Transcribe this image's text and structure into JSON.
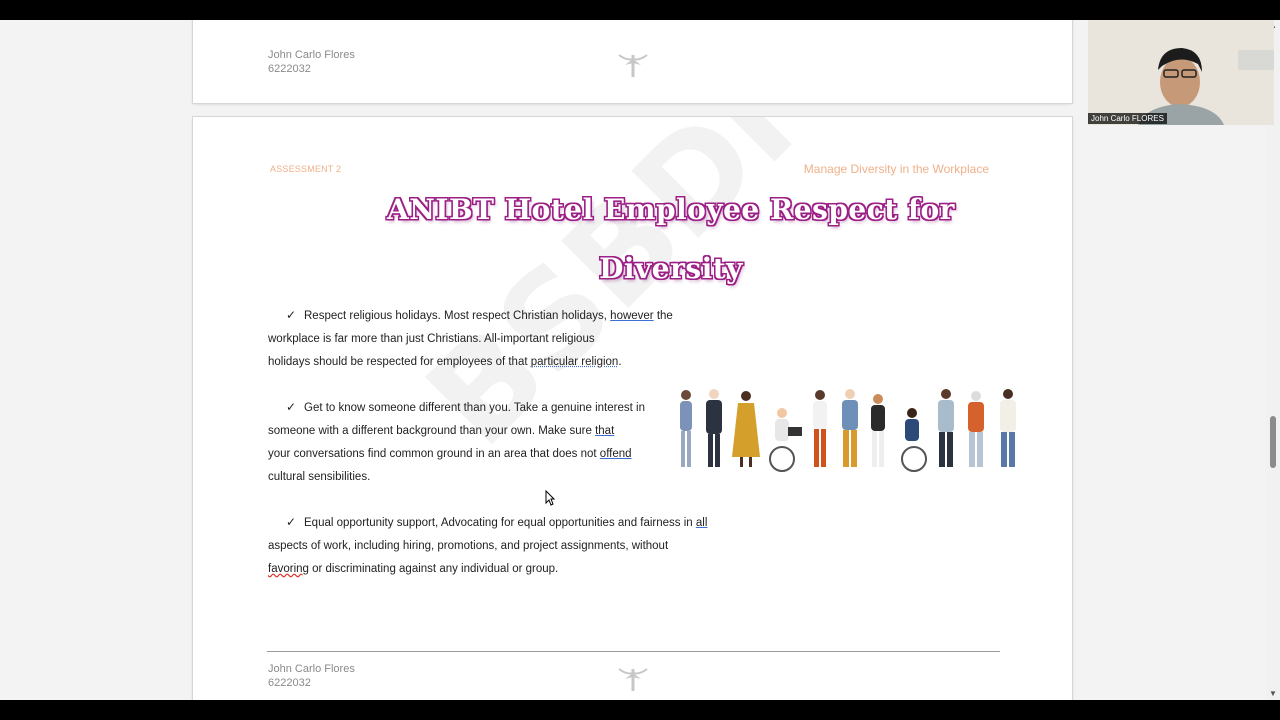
{
  "prev_page": {
    "footer_name": "John Carlo Flores",
    "footer_id": "6222032"
  },
  "page": {
    "header_left": "ASSESSMENT 2",
    "header_right": "Manage Diversity in the Workplace",
    "title_line1": "ANIBT Hotel Employee Respect for",
    "title_line2": "Diversity",
    "watermark": "BSBDIV501",
    "bullets": [
      {
        "line1_pre": "Respect religious holidays. Most respect Christian holidays, ",
        "line1_u": "however",
        "line1_post": " the",
        "line2": "workplace is far more than just Christians. All-important religious",
        "line3_pre": "holidays should be respected for employees of that ",
        "line3_u": "particular religion",
        "line3_post": "."
      },
      {
        "line1": "Get to know someone different than you. Take a genuine interest in",
        "line2_pre": "someone with a different background than your own. Make sure ",
        "line2_u": "that",
        "line3_pre": "your conversations find common ground in an area that does not ",
        "line3_u": "offend",
        "line4": "cultural sensibilities."
      },
      {
        "line1_pre": "Equal opportunity support, Advocating for equal opportunities and fairness in ",
        "line1_u": "all",
        "line2": "aspects of work, including hiring, promotions, and project assignments, without",
        "line3_u": "favoring",
        "line3_post": " or discriminating against any individual or group."
      }
    ],
    "footer_name": "John Carlo Flores",
    "footer_id": "6222032"
  },
  "video": {
    "participant_name": "John Carlo FLORES"
  },
  "colors": {
    "title_outline": "#9c1f86",
    "header_text": "#f0b08a",
    "underline_blue": "#3c6fd1"
  }
}
